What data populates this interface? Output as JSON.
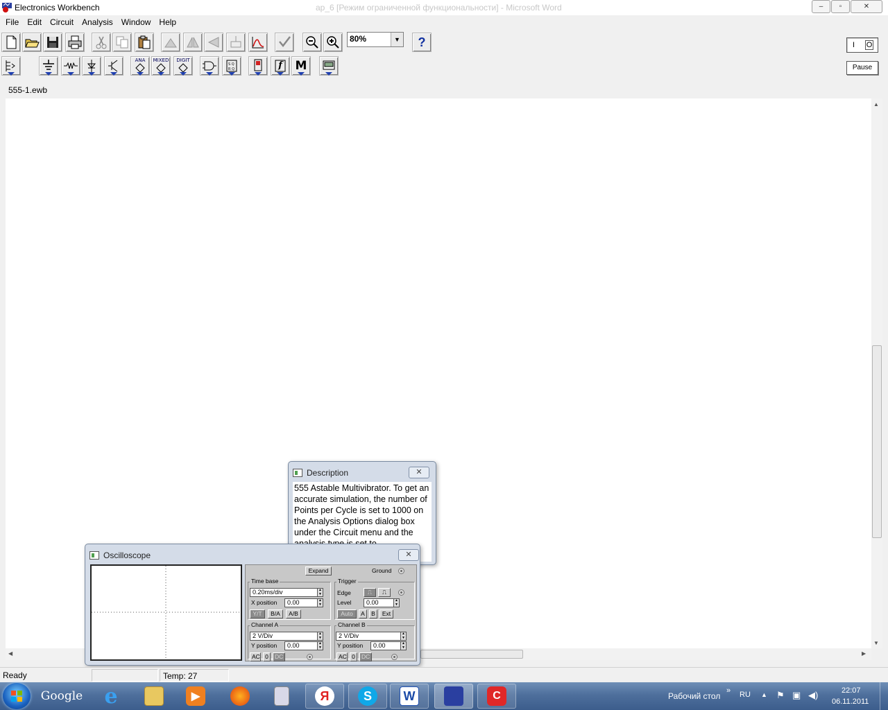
{
  "window": {
    "title": "Electronics Workbench",
    "background_title": "ар_6 [Режим ограниченной функциональности] - Microsoft Word",
    "controls": {
      "minimize": "–",
      "maximize": "▫",
      "close": "✕"
    }
  },
  "menu": [
    "File",
    "Edit",
    "Circuit",
    "Analysis",
    "Window",
    "Help"
  ],
  "toolbar": {
    "zoom_value": "80%",
    "help_label": "?",
    "part_bin_labels": {
      "analog": "ANA",
      "mixed": "MIXED",
      "digital": "DIGIT",
      "misc": "M",
      "func": "f"
    },
    "power_switch": {
      "on_label": "I",
      "off_label": "O"
    },
    "pause_label": "Pause"
  },
  "document": {
    "filename": "555-1.ewb"
  },
  "description_window": {
    "title": "Description",
    "close": "✕",
    "text": "555 Astable Multivibrator. To get an accurate simulation, the number of Points per Cycle is set to 1000 on the Analysis Options dialog box under the Circuit menu and the analysis type is set to"
  },
  "oscilloscope": {
    "title": "Oscilloscope",
    "close": "✕",
    "expand_label": "Expand",
    "ground_label": "Ground",
    "time_base": {
      "label": "Time base",
      "value": "0.20ms/div",
      "xpos_label": "X position",
      "xpos_value": "0.00",
      "modes": [
        "Y/T",
        "B/A",
        "A/B"
      ]
    },
    "trigger": {
      "label": "Trigger",
      "edge_label": "Edge",
      "level_label": "Level",
      "level_value": "0.00",
      "sources": [
        "Auto",
        "A",
        "B",
        "Ext"
      ]
    },
    "channel_a": {
      "label": "Channel A",
      "value": "2  V/Div",
      "ypos_label": "Y position",
      "ypos_value": "0.00",
      "coupling": [
        "AC",
        "0",
        "DC"
      ]
    },
    "channel_b": {
      "label": "Channel B",
      "value": "2  V/Div",
      "ypos_label": "Y position",
      "ypos_value": "0.00",
      "coupling": [
        "AC",
        "0",
        "DC"
      ]
    }
  },
  "status": {
    "ready": "Ready",
    "temp": "Temp:  27"
  },
  "taskbar": {
    "google_label": "Google",
    "yandex_label": "Я",
    "desktop_label": "Рабочий стол",
    "chevron": "»",
    "lang": "RU",
    "time": "22:07",
    "date": "06.11.2011"
  },
  "colors": {
    "accent": "#2040b0",
    "taskbar": "#4e6f9c",
    "panel": "#c8c8c8"
  }
}
